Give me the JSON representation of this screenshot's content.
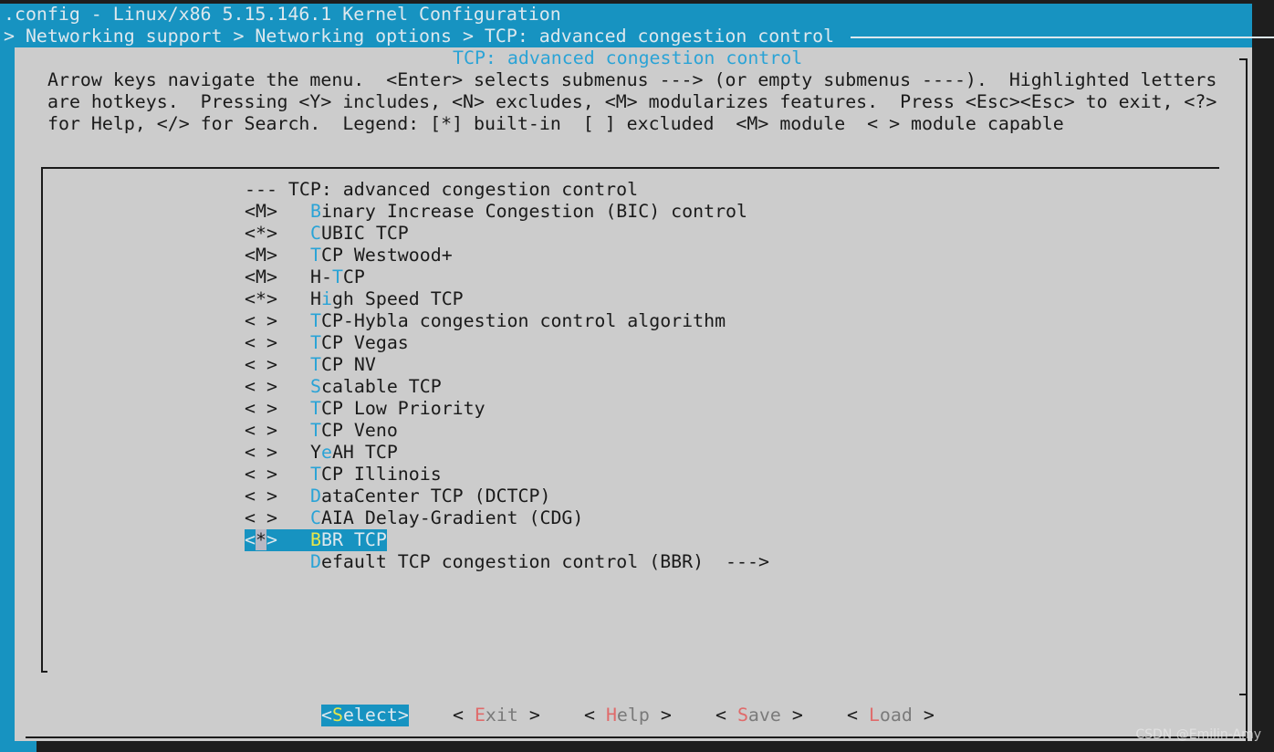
{
  "window_title": ".config - Linux/x86 5.15.146.1 Kernel Configuration",
  "breadcrumb": "> Networking support > Networking options > TCP: advanced congestion control",
  "dialog_title": "TCP: advanced congestion control",
  "help_lines": [
    "Arrow keys navigate the menu.  <Enter> selects submenus ---> (or empty submenus ----).  Highlighted letters",
    "are hotkeys.  Pressing <Y> includes, <N> excludes, <M> modularizes features.  Press <Esc><Esc> to exit, <?>",
    "for Help, </> for Search.  Legend: [*] built-in  [ ] excluded  <M> module  < > module capable"
  ],
  "menu_header": "--- TCP: advanced congestion control",
  "menu_items": [
    {
      "state": "<M>",
      "label": "Binary Increase Congestion (BIC) control",
      "hotkey": 0
    },
    {
      "state": "<*>",
      "label": "CUBIC TCP",
      "hotkey": 0
    },
    {
      "state": "<M>",
      "label": "TCP Westwood+",
      "hotkey": 0
    },
    {
      "state": "<M>",
      "label": "H-TCP",
      "hotkey": 2
    },
    {
      "state": "<*>",
      "label": "High Speed TCP",
      "hotkey": 1
    },
    {
      "state": "< >",
      "label": "TCP-Hybla congestion control algorithm",
      "hotkey": 0
    },
    {
      "state": "< >",
      "label": "TCP Vegas",
      "hotkey": 0
    },
    {
      "state": "< >",
      "label": "TCP NV",
      "hotkey": 0
    },
    {
      "state": "< >",
      "label": "Scalable TCP",
      "hotkey": 0
    },
    {
      "state": "< >",
      "label": "TCP Low Priority",
      "hotkey": 0
    },
    {
      "state": "< >",
      "label": "TCP Veno",
      "hotkey": 0
    },
    {
      "state": "< >",
      "label": "YeAH TCP",
      "hotkey": 1
    },
    {
      "state": "< >",
      "label": "TCP Illinois",
      "hotkey": 0
    },
    {
      "state": "< >",
      "label": "DataCenter TCP (DCTCP)",
      "hotkey": 0
    },
    {
      "state": "< >",
      "label": "CAIA Delay-Gradient (CDG)",
      "hotkey": 0
    },
    {
      "state": "<*>",
      "label": "BBR TCP",
      "hotkey": 0,
      "selected": true
    },
    {
      "state": "",
      "label": "Default TCP congestion control (BBR)  --->",
      "hotkey": 0
    }
  ],
  "buttons": [
    {
      "label": "Select",
      "active": true
    },
    {
      "label": "Exit"
    },
    {
      "label": "Help"
    },
    {
      "label": "Save"
    },
    {
      "label": "Load"
    }
  ],
  "watermark": "CSDN @Emilin-Amy",
  "colors": {
    "background_blue": "#1793c1",
    "dialog_gray": "#cccccc",
    "hotkey": "#2aa3d6",
    "button_hotkey": "#e06a6a",
    "selected_hotkey": "#e6e64a"
  }
}
